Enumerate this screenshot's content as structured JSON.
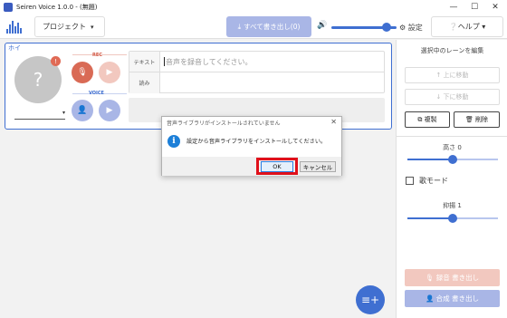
{
  "window": {
    "title": "Seiren Voice 1.0.0 - (無題)",
    "minimize": "—",
    "maximize": "☐",
    "close": "✕"
  },
  "toolbar": {
    "project_label": "プロジェクト",
    "project_caret": "▾",
    "export_all_icon": "⤓",
    "export_all_label": "すべて書き出し(0)",
    "volume_icon": "🔊",
    "volume_level": 0.85,
    "settings_label": "⚙ 設定",
    "help_label": "❔ヘルプ ▾"
  },
  "lane": {
    "name": "ホイ",
    "avatar_placeholder": "?",
    "avatar_badge": "!",
    "speaker_caret": "▾",
    "rec_label": "REC",
    "voice_label": "VOICE",
    "mic_icon": "🎙",
    "play_icon": "▶",
    "voice_icon": "👤",
    "text_row_label": "テキスト",
    "text_placeholder": "音声を録音してください。",
    "reading_row_label": "読み",
    "reading_value": ""
  },
  "fab": {
    "icon": "≡+"
  },
  "right_panel": {
    "title": "選択中のレーンを編集",
    "move_up": "↑ 上に移動",
    "move_down": "↓ 下に移動",
    "duplicate": "⧉ 複製",
    "delete": "🗑 削除",
    "pitch_label": "高さ 0",
    "pitch_value": 0.5,
    "song_mode": "歌モード",
    "speed_label": "抑揚 1",
    "speed_value": 0.5,
    "export_rec": "🎙 録音 書き出し",
    "export_voice": "👤 合成 書き出し"
  },
  "dialog": {
    "title": "音声ライブラリがインストールされていません",
    "close": "✕",
    "info_icon": "i",
    "message": "設定から音声ライブラリをインストールしてください。",
    "ok": "OK",
    "cancel": "キャンセル"
  },
  "colors": {
    "accent": "#3f6fd1",
    "rec": "#d96a55",
    "highlight": "#e0101a"
  }
}
